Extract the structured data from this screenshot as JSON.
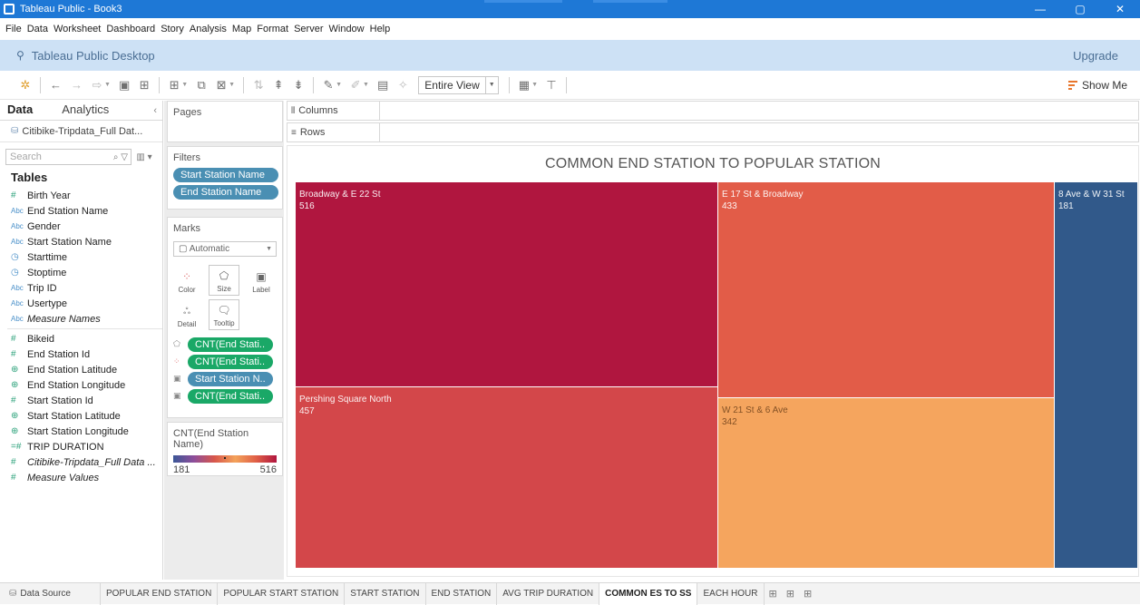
{
  "window": {
    "title": "Tableau Public - Book3",
    "minimize": "—",
    "maximize": "▢",
    "close": "✕"
  },
  "menu": [
    "File",
    "Data",
    "Worksheet",
    "Dashboard",
    "Story",
    "Analysis",
    "Map",
    "Format",
    "Server",
    "Window",
    "Help"
  ],
  "public_bar": {
    "title": "Tableau Public Desktop",
    "upgrade": "Upgrade"
  },
  "toolbar": {
    "fit": "Entire View",
    "show_me": "Show Me"
  },
  "data_pane": {
    "tab_data": "Data",
    "tab_analytics": "Analytics",
    "source": "Citibike-Tripdata_Full Dat...",
    "search_placeholder": "Search",
    "tables_heading": "Tables",
    "dimensions": [
      {
        "type": "measure",
        "name": "Birth Year"
      },
      {
        "type": "abc",
        "name": "End Station Name"
      },
      {
        "type": "abc",
        "name": "Gender"
      },
      {
        "type": "abc",
        "name": "Start Station Name"
      },
      {
        "type": "datetime",
        "name": "Starttime"
      },
      {
        "type": "datetime",
        "name": "Stoptime"
      },
      {
        "type": "abc",
        "name": "Trip ID"
      },
      {
        "type": "abc",
        "name": "Usertype"
      },
      {
        "type": "abc",
        "name": "Measure Names"
      }
    ],
    "measures": [
      {
        "type": "measure",
        "name": "Bikeid"
      },
      {
        "type": "measure",
        "name": "End Station Id"
      },
      {
        "type": "geo",
        "name": "End Station Latitude"
      },
      {
        "type": "geo",
        "name": "End Station Longitude"
      },
      {
        "type": "measure",
        "name": "Start Station Id"
      },
      {
        "type": "geo",
        "name": "Start Station Latitude"
      },
      {
        "type": "geo",
        "name": "Start Station Longitude"
      },
      {
        "type": "calc",
        "name": "TRIP DURATION"
      },
      {
        "type": "measure",
        "name": "Citibike-Tripdata_Full Data ..."
      },
      {
        "type": "measure",
        "name": "Measure Values"
      }
    ]
  },
  "pages": {
    "title": "Pages"
  },
  "filters": {
    "title": "Filters",
    "items": [
      "Start Station Name",
      "End Station Name"
    ]
  },
  "marks": {
    "title": "Marks",
    "type": "Automatic",
    "buttons": {
      "color": "Color",
      "size": "Size",
      "label": "Label",
      "detail": "Detail",
      "tooltip": "Tooltip"
    },
    "fields": [
      {
        "encoding": "size",
        "label": "CNT(End Stati..",
        "color": "green"
      },
      {
        "encoding": "color",
        "label": "CNT(End Stati..",
        "color": "green"
      },
      {
        "encoding": "label",
        "label": "Start Station N..",
        "color": "blue"
      },
      {
        "encoding": "label",
        "label": "CNT(End Stati..",
        "color": "green"
      }
    ]
  },
  "legend": {
    "title": "CNT(End Station Name)",
    "min": "181",
    "max": "516"
  },
  "shelves": {
    "columns": "Columns",
    "rows": "Rows"
  },
  "viz": {
    "title": "COMMON END STATION TO POPULAR STATION",
    "cells": [
      {
        "name": "Broadway & E 22 St",
        "value": "516",
        "color": "#b0163f"
      },
      {
        "name": "E 17 St & Broadway",
        "value": "433",
        "color": "#e25c48"
      },
      {
        "name": "8 Ave & W 31 St",
        "value": "181",
        "color": "#31598a"
      },
      {
        "name": "Pershing Square North",
        "value": "457",
        "color": "#d3474a"
      },
      {
        "name": "W 21 St & 6 Ave",
        "value": "342",
        "color": "#f5a55e"
      }
    ]
  },
  "bottom_tabs": {
    "data_source": "Data Source",
    "sheets": [
      "POPULAR END STATION",
      "POPULAR START STATION",
      "START STATION",
      "END STATION",
      "AVG TRIP DURATION",
      "COMMON ES TO SS",
      "EACH HOUR"
    ],
    "active": "COMMON ES TO SS"
  }
}
